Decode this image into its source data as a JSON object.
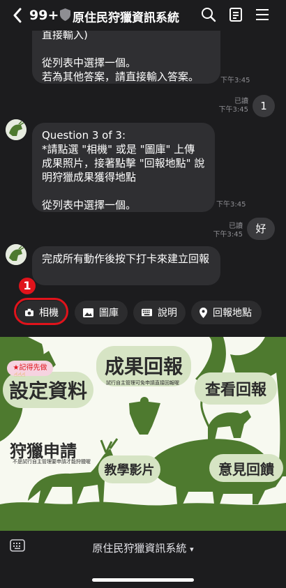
{
  "header": {
    "unread_count": "99+",
    "title": "原住民狩獵資訊系統",
    "icons": [
      "back-chevron-icon",
      "shield-icon",
      "search-icon",
      "notes-icon",
      "menu-icon"
    ]
  },
  "messages": {
    "m1_text": "直接輸入)\n\n從列表中選擇一個。\n若為其他答案，請直接輸入答案。",
    "m1_time": "下午3:45",
    "u1_text": "1",
    "u1_meta": "已讀\n下午3:45",
    "m2_text": "Question 3 of 3:\n *請點選 \"相機\" 或是 \"圖庫\" 上傳成果照片，接著點擊 \"回報地點\" 說明狩獵成果獲得地點\n\n從列表中選擇一個。",
    "m2_time": "下午3:45",
    "u2_text": "好",
    "u2_meta": "已讀\n下午3:45",
    "m3_text": "完成所有動作後按下打卡來建立回報"
  },
  "quick_replies": {
    "camera": "相機",
    "gallery": "圖庫",
    "explain": "說明",
    "location": "回報地點",
    "step_badge": "1"
  },
  "rich_menu": {
    "remember_note": "記得先做",
    "settings": "設定資料",
    "report_results": "成果回報",
    "report_results_note": "試行自主管理可免申請直接回報喔",
    "view_reports": "查看回報",
    "hunting_apply": "狩獵申請",
    "hunting_apply_note": "不是試行自主管理要申請才能狩獵喔",
    "tutorial": "教學影片",
    "feedback": "意見回饋"
  },
  "bottom": {
    "menu_title": "原住民狩獵資訊系統",
    "dropdown_glyph": "▾"
  },
  "colors": {
    "background": "#1c1c1e",
    "bubble": "#2f2f32",
    "highlight": "#e0131b",
    "menu_pill": "#d6e4c4",
    "silhouette": "#4e7a2f"
  }
}
